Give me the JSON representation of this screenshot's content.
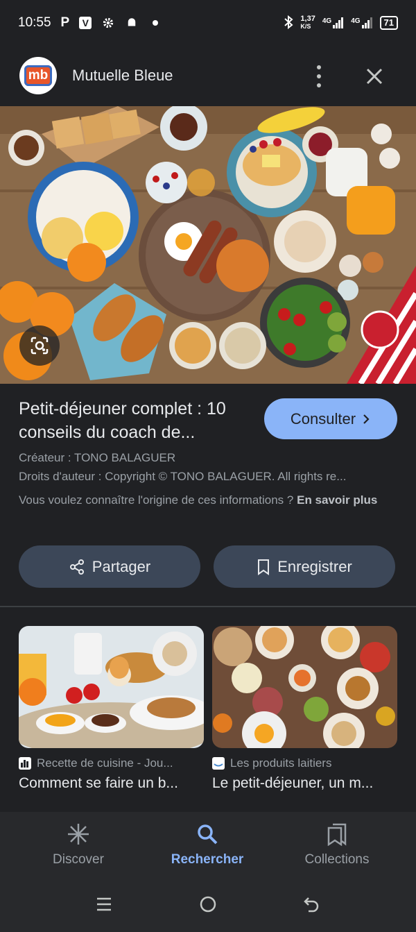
{
  "status_bar": {
    "time": "10:55",
    "left_icons": [
      "P",
      "V",
      "gear-icon",
      "android-icon",
      "dot-icon"
    ],
    "net_speed": "1,37",
    "net_speed_unit": "K/S",
    "network1": "4G",
    "network2": "4G",
    "battery": "71"
  },
  "header": {
    "site_name": "Mutuelle Bleue",
    "logo_text": "mb"
  },
  "result": {
    "title": "Petit-déjeuner complet : 10 conseils du coach de...",
    "consult_label": "Consulter",
    "creator": "Créateur : TONO BALAGUER",
    "copyright": "Droits d'auteur : Copyright © TONO BALAGUER. All rights re...",
    "info_question": "Vous voulez connaître l'origine de ces informations ?",
    "info_link": "En savoir plus"
  },
  "actions": {
    "share_label": "Partager",
    "save_label": "Enregistrer"
  },
  "related": [
    {
      "source": "Recette de cuisine - Jou...",
      "title": "Comment se faire un b..."
    },
    {
      "source": "Les produits laitiers",
      "title": "Le petit-déjeuner, un m..."
    }
  ],
  "bottom_nav": {
    "items": [
      {
        "label": "Discover",
        "icon": "asterisk-icon",
        "active": false
      },
      {
        "label": "Rechercher",
        "icon": "search-icon",
        "active": true
      },
      {
        "label": "Collections",
        "icon": "collections-icon",
        "active": false
      }
    ]
  },
  "colors": {
    "background": "#202124",
    "accent": "#8ab4f8",
    "button_bg": "#3c4758",
    "nav_bg": "#28292c"
  }
}
